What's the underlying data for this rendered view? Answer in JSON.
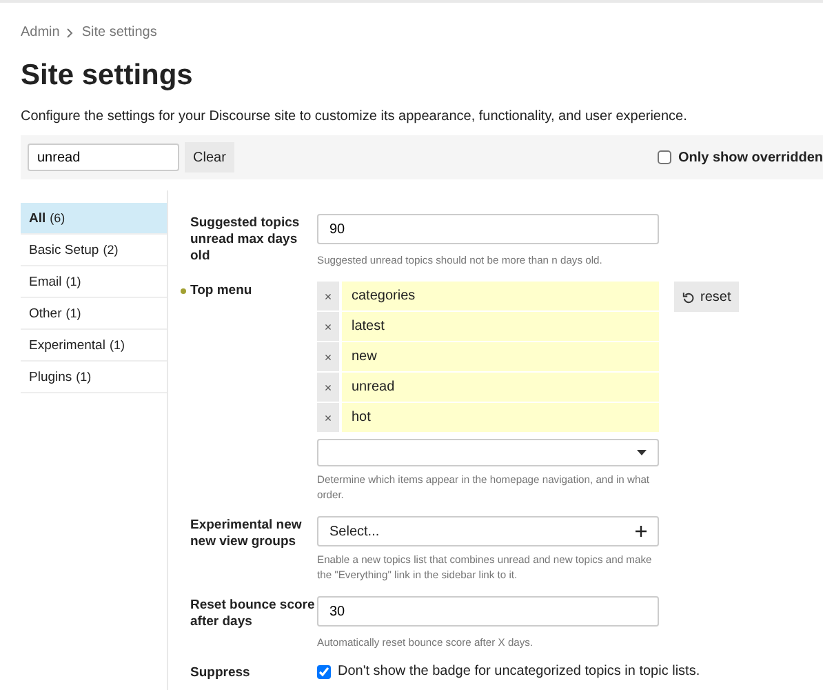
{
  "breadcrumb": [
    "Admin",
    "Site settings"
  ],
  "title": "Site settings",
  "description": "Configure the settings for your Discourse site to customize its appearance, functionality, and user experience.",
  "filter": {
    "value": "unread",
    "clear_button": "Clear",
    "only_overridden": {
      "label": "Only show overridden",
      "checked": false
    }
  },
  "sidebar": {
    "items": [
      {
        "label": "All",
        "count": "(6)",
        "selected": true
      },
      {
        "label": "Basic Setup",
        "count": "(2)",
        "selected": false
      },
      {
        "label": "Email",
        "count": "(1)",
        "selected": false
      },
      {
        "label": "Other",
        "count": "(1)",
        "selected": false
      },
      {
        "label": "Experimental",
        "count": "(1)",
        "selected": false
      },
      {
        "label": "Plugins",
        "count": "(1)",
        "selected": false
      }
    ]
  },
  "settings": [
    {
      "kind": "text",
      "label": "Suggested topics unread max days old",
      "overridden": false,
      "value": "90",
      "help": "Suggested unread topics should not be more than n days old."
    },
    {
      "kind": "list",
      "label": "Top menu",
      "overridden": true,
      "items": [
        "categories",
        "latest",
        "new",
        "unread",
        "hot"
      ],
      "remove_glyph": "×",
      "reset_button": "reset",
      "help": "Determine which items appear in the homepage navigation, and in what order."
    },
    {
      "kind": "select",
      "label": "Experimental new new view groups",
      "overridden": false,
      "placeholder": "Select...",
      "help": "Enable a new topics list that combines unread and new topics and make the \"Everything\" link in the sidebar link to it."
    },
    {
      "kind": "text",
      "label": "Reset bounce score after days",
      "overridden": false,
      "value": "30",
      "help": "Automatically reset bounce score after X days."
    },
    {
      "kind": "checkbox",
      "label": "Suppress",
      "overridden": false,
      "checked": true,
      "checkbox_label": "Don't show the badge for uncategorized topics in topic lists."
    }
  ]
}
